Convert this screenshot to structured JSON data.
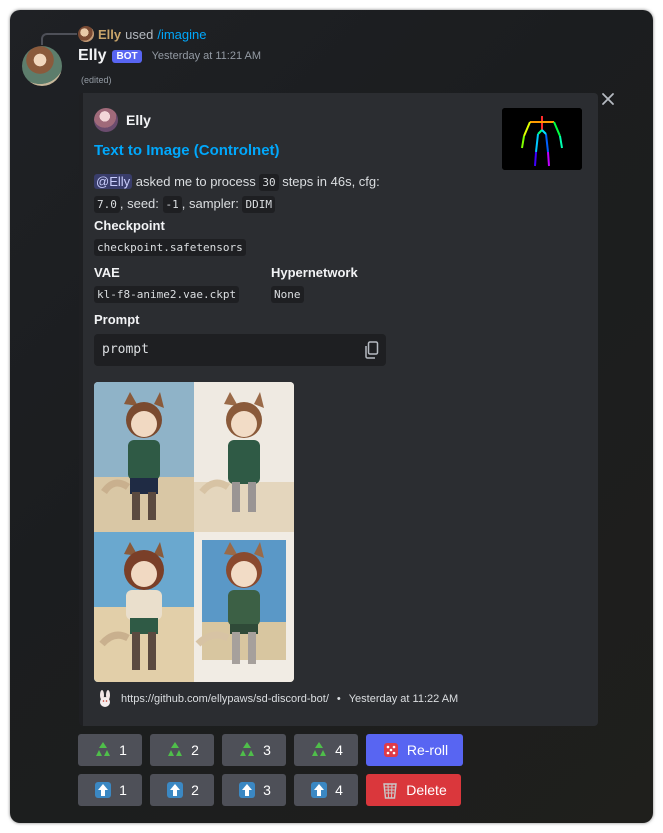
{
  "reply": {
    "user": "Elly",
    "used": "used",
    "command": "/imagine"
  },
  "author": {
    "name": "Elly",
    "tag": "BOT",
    "timestamp": "Yesterday at 11:21 AM",
    "edited": "(edited)"
  },
  "embed": {
    "author_name": "Elly",
    "title": "Text to Image (Controlnet)",
    "desc": {
      "mention": "@Elly",
      "t1": " asked me to process ",
      "steps": "30",
      "t2": " steps in 46s, cfg:",
      "cfg": "7.0",
      "t3": ", seed: ",
      "seed": "-1",
      "t4": ", sampler: ",
      "sampler": "DDIM"
    },
    "fields": {
      "checkpoint_name": "Checkpoint",
      "checkpoint_value": "checkpoint.safetensors",
      "vae_name": "VAE",
      "vae_value": "kl-f8-anime2.vae.ckpt",
      "hypernetwork_name": "Hypernetwork",
      "hypernetwork_value": "None",
      "prompt_name": "Prompt",
      "prompt_value": "prompt"
    },
    "footer": {
      "url": "https://github.com/ellypaws/sd-discord-bot/",
      "sep": "•",
      "time": "Yesterday at 11:22 AM"
    }
  },
  "icons": {
    "close": "close-icon",
    "copy": "copy-icon",
    "reroll": "game-die-icon",
    "delete": "wastebasket-icon",
    "variation": "recycle-icon",
    "upscale": "up-arrow-icon"
  },
  "buttons": {
    "variations": [
      "1",
      "2",
      "3",
      "4"
    ],
    "upscales": [
      "1",
      "2",
      "3",
      "4"
    ],
    "reroll": "Re-roll",
    "delete": "Delete"
  },
  "colors": {
    "accent": "#00a8fc",
    "blurple": "#5865f2",
    "danger": "#da373c",
    "embed_bg": "#2b2d31"
  }
}
